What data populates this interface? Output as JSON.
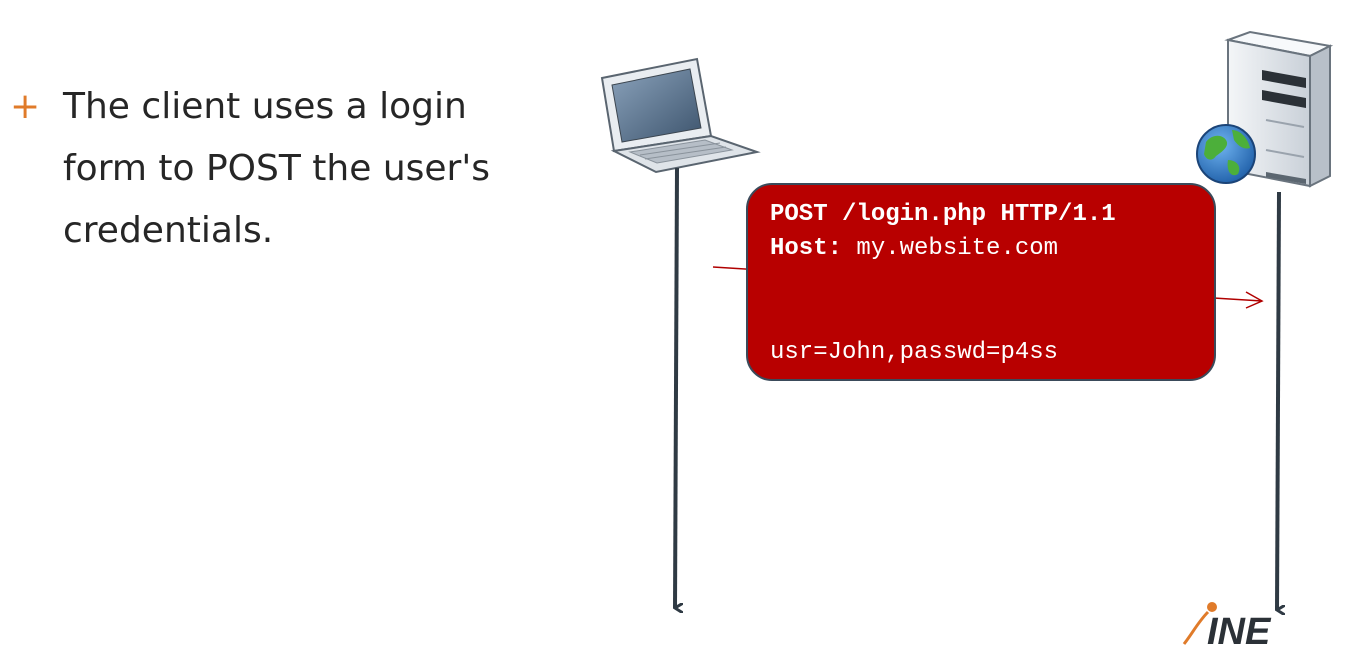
{
  "bullet": {
    "marker": "+",
    "text": "The client uses a login form to POST the user's credentials."
  },
  "request": {
    "line1": "POST /login.php HTTP/1.1",
    "host_key": "Host:",
    "host_value": "my.website.com",
    "body": "usr=John,passwd=p4ss"
  },
  "logo": {
    "text": "INE"
  },
  "colors": {
    "accent": "#e07b2a",
    "request_fill": "#b80000",
    "timeline": "#2f3a44",
    "message_arrow": "#b00000"
  },
  "icons": {
    "client": "laptop-icon",
    "server": "server-icon",
    "globe": "globe-icon"
  }
}
